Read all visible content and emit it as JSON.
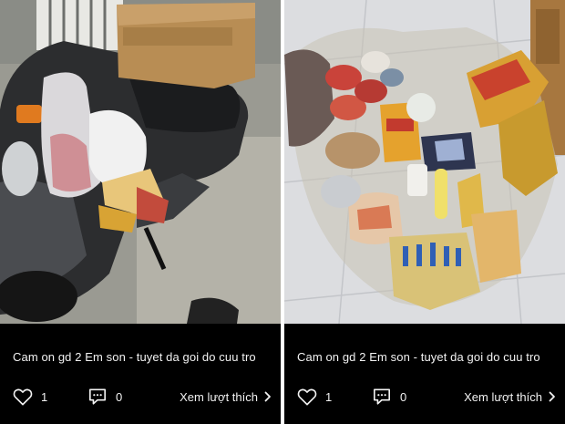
{
  "posts": [
    {
      "photo_label": "scooter-with-relief-goods-photo",
      "caption": "Cam on gd 2 Em son - tuyet da goi do cuu tro",
      "like_count": "1",
      "comment_count": "0",
      "see_likes_label": "Xem lượt thích",
      "icons": {
        "like": "heart-icon",
        "comment": "comment-icon",
        "chevron": "chevron-right-icon"
      }
    },
    {
      "photo_label": "groceries-on-floor-photo",
      "caption": "Cam on gd 2 Em son - tuyet da goi do cuu tro",
      "like_count": "1",
      "comment_count": "0",
      "see_likes_label": "Xem lượt thích",
      "icons": {
        "like": "heart-icon",
        "comment": "comment-icon",
        "chevron": "chevron-right-icon"
      }
    }
  ],
  "colors": {
    "card_background": "#000000",
    "text": "#f2f2f2",
    "page_background": "#ffffff"
  }
}
